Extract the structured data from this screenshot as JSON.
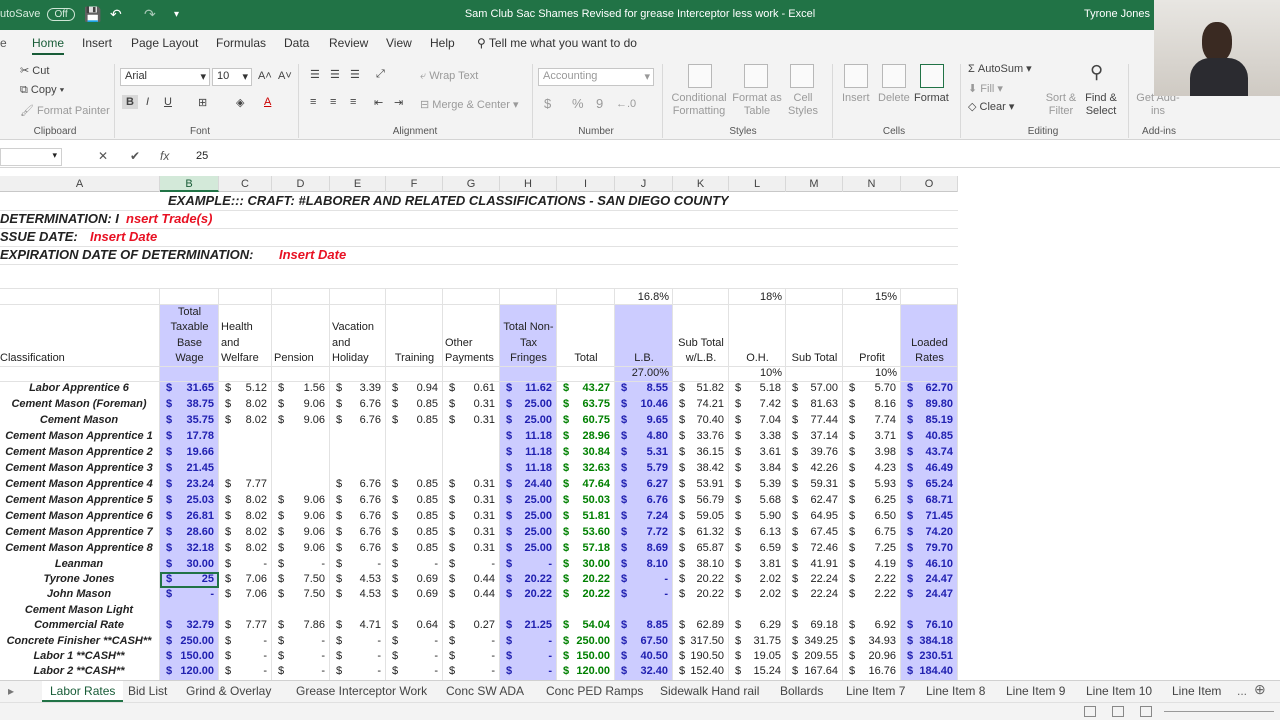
{
  "titlebar": {
    "autosave_label": "utoSave",
    "autosave_state": "Off",
    "document_title": "Sam Club Sac Shames Revised for grease Interceptor less work  -  Excel",
    "user_name": "Tyrone Jones",
    "icons": [
      "save-icon",
      "undo-icon",
      "redo-icon",
      "customize-icon"
    ]
  },
  "ribbon_tabs": [
    "Home",
    "Insert",
    "Page Layout",
    "Formulas",
    "Data",
    "Review",
    "View",
    "Help"
  ],
  "tell_me": "Tell me what you want to do",
  "ribbon": {
    "clipboard": {
      "cut": "Cut",
      "copy": "Copy",
      "format_painter": "Format Painter",
      "group": "Clipboard"
    },
    "font": {
      "name": "Arial",
      "size": "10",
      "bold": "B",
      "italic": "I",
      "underline": "U",
      "group": "Font"
    },
    "alignment": {
      "wrap": "Wrap Text",
      "merge": "Merge & Center",
      "group": "Alignment"
    },
    "number": {
      "format": "Accounting",
      "currency": "$",
      "percent": "%",
      "comma": "9",
      "group": "Number"
    },
    "styles": {
      "conditional": "Conditional Formatting",
      "format_table": "Format as Table",
      "cell_styles": "Cell Styles",
      "group": "Styles"
    },
    "cells": {
      "insert": "Insert",
      "delete": "Delete",
      "format": "Format",
      "group": "Cells"
    },
    "editing": {
      "autosum": "AutoSum",
      "fill": "Fill",
      "clear": "Clear",
      "sort": "Sort & Filter",
      "find": "Find & Select",
      "group": "Editing"
    },
    "addins": {
      "get": "Get Add-ins",
      "group": "Add-ins"
    }
  },
  "formula_bar": {
    "value": "25",
    "cancel": "✕",
    "enter": "✔",
    "fx": "fx"
  },
  "columns": [
    "A",
    "B",
    "C",
    "D",
    "E",
    "F",
    "G",
    "H",
    "I",
    "J",
    "K",
    "L",
    "M",
    "N",
    "O"
  ],
  "selected_column": "B",
  "header": {
    "line1": "EXAMPLE:::  CRAFT: #LABORER AND RELATED CLASSIFICATIONS - SAN DIEGO COUNTY",
    "det_label": "DETERMINATION: I",
    "det_value": "nsert Trade(s)",
    "issue_label": "SSUE DATE:",
    "issue_value": "Insert Date",
    "exp_label": "EXPIRATION DATE OF DETERMINATION:",
    "exp_value": "Insert Date"
  },
  "percents": {
    "lb": "16.8%",
    "oh": "18%",
    "profit": "15%",
    "lb2": "27.00%",
    "oh2": "10%",
    "profit2": "10%"
  },
  "column_headings": {
    "classification": "Classification",
    "b": [
      "Total",
      "Taxable",
      "Base",
      "Wage"
    ],
    "c": [
      "Health",
      "and",
      "Welfare"
    ],
    "d": [
      "Pension"
    ],
    "e": [
      "Vacation",
      "and",
      "Holiday"
    ],
    "f": [
      "Training"
    ],
    "g": [
      "Other",
      "Payments"
    ],
    "h": [
      "Total Non-",
      "Tax",
      "Fringes"
    ],
    "i": [
      "Total"
    ],
    "j": [
      "L.B."
    ],
    "k": [
      "Sub Total",
      "w/L.B."
    ],
    "l": [
      "O.H."
    ],
    "m": [
      "Sub Total"
    ],
    "n": [
      "Profit"
    ],
    "o": [
      "Loaded",
      "Rates"
    ]
  },
  "rows": [
    {
      "name": "Labor Apprentice 6",
      "b": "31.65",
      "c": "5.12",
      "d": "1.56",
      "e": "3.39",
      "f": "0.94",
      "g": "0.61",
      "h": "11.62",
      "i": "43.27",
      "j": "8.55",
      "k": "51.82",
      "l": "5.18",
      "m": "57.00",
      "n": "5.70",
      "o": "62.70"
    },
    {
      "name": "Cement Mason (Foreman)",
      "b": "38.75",
      "c": "8.02",
      "d": "9.06",
      "e": "6.76",
      "f": "0.85",
      "g": "0.31",
      "h": "25.00",
      "i": "63.75",
      "j": "10.46",
      "k": "74.21",
      "l": "7.42",
      "m": "81.63",
      "n": "8.16",
      "o": "89.80"
    },
    {
      "name": "Cement Mason",
      "b": "35.75",
      "c": "8.02",
      "d": "9.06",
      "e": "6.76",
      "f": "0.85",
      "g": "0.31",
      "h": "25.00",
      "i": "60.75",
      "j": "9.65",
      "k": "70.40",
      "l": "7.04",
      "m": "77.44",
      "n": "7.74",
      "o": "85.19"
    },
    {
      "name": "Cement Mason Apprentice 1",
      "b": "17.78",
      "c": "",
      "d": "",
      "e": "",
      "f": "",
      "g": "",
      "h": "11.18",
      "i": "28.96",
      "j": "4.80",
      "k": "33.76",
      "l": "3.38",
      "m": "37.14",
      "n": "3.71",
      "o": "40.85"
    },
    {
      "name": "Cement Mason Apprentice 2",
      "b": "19.66",
      "c": "",
      "d": "",
      "e": "",
      "f": "",
      "g": "",
      "h": "11.18",
      "i": "30.84",
      "j": "5.31",
      "k": "36.15",
      "l": "3.61",
      "m": "39.76",
      "n": "3.98",
      "o": "43.74"
    },
    {
      "name": "Cement Mason Apprentice 3",
      "b": "21.45",
      "c": "",
      "d": "",
      "e": "",
      "f": "",
      "g": "",
      "h": "11.18",
      "i": "32.63",
      "j": "5.79",
      "k": "38.42",
      "l": "3.84",
      "m": "42.26",
      "n": "4.23",
      "o": "46.49"
    },
    {
      "name": "Cement Mason Apprentice 4",
      "b": "23.24",
      "c": "7.77",
      "d": "",
      "e": "6.76",
      "f": "0.85",
      "g": "0.31",
      "h": "24.40",
      "i": "47.64",
      "j": "6.27",
      "k": "53.91",
      "l": "5.39",
      "m": "59.31",
      "n": "5.93",
      "o": "65.24"
    },
    {
      "name": "Cement Mason Apprentice 5",
      "b": "25.03",
      "c": "8.02",
      "d": "9.06",
      "e": "6.76",
      "f": "0.85",
      "g": "0.31",
      "h": "25.00",
      "i": "50.03",
      "j": "6.76",
      "k": "56.79",
      "l": "5.68",
      "m": "62.47",
      "n": "6.25",
      "o": "68.71"
    },
    {
      "name": "Cement Mason Apprentice 6",
      "b": "26.81",
      "c": "8.02",
      "d": "9.06",
      "e": "6.76",
      "f": "0.85",
      "g": "0.31",
      "h": "25.00",
      "i": "51.81",
      "j": "7.24",
      "k": "59.05",
      "l": "5.90",
      "m": "64.95",
      "n": "6.50",
      "o": "71.45"
    },
    {
      "name": "Cement Mason Apprentice 7",
      "b": "28.60",
      "c": "8.02",
      "d": "9.06",
      "e": "6.76",
      "f": "0.85",
      "g": "0.31",
      "h": "25.00",
      "i": "53.60",
      "j": "7.72",
      "k": "61.32",
      "l": "6.13",
      "m": "67.45",
      "n": "6.75",
      "o": "74.20"
    },
    {
      "name": "Cement Mason Apprentice 8",
      "b": "32.18",
      "c": "8.02",
      "d": "9.06",
      "e": "6.76",
      "f": "0.85",
      "g": "0.31",
      "h": "25.00",
      "i": "57.18",
      "j": "8.69",
      "k": "65.87",
      "l": "6.59",
      "m": "72.46",
      "n": "7.25",
      "o": "79.70"
    },
    {
      "name": "Leanman",
      "b": "30.00",
      "c": "-",
      "d": "-",
      "e": "-",
      "f": "-",
      "g": "-",
      "h": "-",
      "i": "30.00",
      "j": "8.10",
      "k": "38.10",
      "l": "3.81",
      "m": "41.91",
      "n": "4.19",
      "o": "46.10"
    },
    {
      "name": "Tyrone Jones",
      "b": "25",
      "c": "7.06",
      "d": "7.50",
      "e": "4.53",
      "f": "0.69",
      "g": "0.44",
      "h": "20.22",
      "i": "20.22",
      "j": "-",
      "k": "20.22",
      "l": "2.02",
      "m": "22.24",
      "n": "2.22",
      "o": "24.47"
    },
    {
      "name": "John Mason",
      "b": "-",
      "c": "7.06",
      "d": "7.50",
      "e": "4.53",
      "f": "0.69",
      "g": "0.44",
      "h": "20.22",
      "i": "20.22",
      "j": "-",
      "k": "20.22",
      "l": "2.02",
      "m": "22.24",
      "n": "2.22",
      "o": "24.47"
    },
    {
      "name": "Cement Mason Light",
      "blank": true
    },
    {
      "name": "Commercial Rate",
      "b": "32.79",
      "c": "7.77",
      "d": "7.86",
      "e": "4.71",
      "f": "0.64",
      "g": "0.27",
      "h": "21.25",
      "i": "54.04",
      "j": "8.85",
      "k": "62.89",
      "l": "6.29",
      "m": "69.18",
      "n": "6.92",
      "o": "76.10"
    },
    {
      "name": "Concrete Finisher **CASH**",
      "b": "250.00",
      "c": "-",
      "d": "-",
      "e": "-",
      "f": "-",
      "g": "-",
      "h": "-",
      "i": "250.00",
      "j": "67.50",
      "k": "317.50",
      "l": "31.75",
      "m": "349.25",
      "n": "34.93",
      "o": "384.18"
    },
    {
      "name": "Labor 1 **CASH**",
      "b": "150.00",
      "c": "-",
      "d": "-",
      "e": "-",
      "f": "-",
      "g": "-",
      "h": "-",
      "i": "150.00",
      "j": "40.50",
      "k": "190.50",
      "l": "19.05",
      "m": "209.55",
      "n": "20.96",
      "o": "230.51"
    },
    {
      "name": "Labor 2 **CASH**",
      "b": "120.00",
      "c": "-",
      "d": "-",
      "e": "-",
      "f": "-",
      "g": "-",
      "h": "-",
      "i": "120.00",
      "j": "32.40",
      "k": "152.40",
      "l": "15.24",
      "m": "167.64",
      "n": "16.76",
      "o": "184.40"
    }
  ],
  "sheet_tabs": [
    "Labor Rates",
    "Bid List",
    "Grind & Overlay",
    "Grease Interceptor Work",
    "Conc SW ADA",
    "Conc PED Ramps",
    "Sidewalk Hand rail",
    "Bollards",
    "Line Item 7",
    "Line Item 8",
    "Line Item 9",
    "Line Item 10",
    "Line Item"
  ],
  "colors": {
    "excel_green": "#217346",
    "band_blue": "#ccccff",
    "red_text": "#e81123",
    "blue_text": "#2020b0",
    "green_text": "#008000"
  }
}
